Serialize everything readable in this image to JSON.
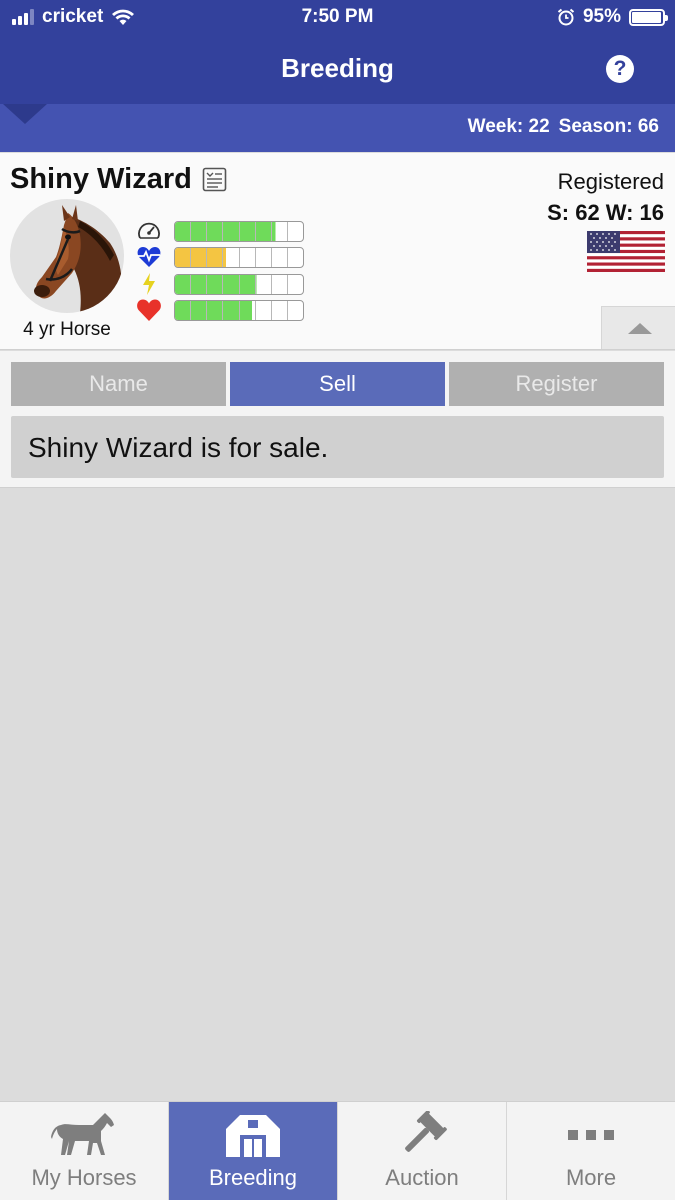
{
  "status_bar": {
    "carrier": "cricket",
    "time": "7:50 PM",
    "battery_percent": "95%",
    "battery_level": 0.95
  },
  "nav": {
    "title": "Breeding",
    "help_glyph": "?"
  },
  "week_bar": {
    "week_label": "Week: 22",
    "season_label": "Season: 66"
  },
  "horse": {
    "name": "Shiny Wizard",
    "age_label": "4 yr Horse",
    "registration_status": "Registered",
    "stat_s": "S: 62",
    "stat_w": "W: 16",
    "flag_icon": "us-flag-icon",
    "stats": [
      {
        "icon": "speed-gauge-icon",
        "level": 0.78,
        "color": "#6fdb5a"
      },
      {
        "icon": "heart-rate-icon",
        "level": 0.4,
        "color": "#f4c542"
      },
      {
        "icon": "lightning-icon",
        "level": 0.63,
        "color": "#6fdb5a"
      },
      {
        "icon": "heart-icon",
        "level": 0.6,
        "color": "#6fdb5a"
      }
    ]
  },
  "tabs": [
    {
      "label": "Name",
      "active": false
    },
    {
      "label": "Sell",
      "active": true
    },
    {
      "label": "Register",
      "active": false
    }
  ],
  "message": "Shiny Wizard is for sale.",
  "tab_bar": [
    {
      "label": "My Horses",
      "icon": "horse-icon",
      "active": false
    },
    {
      "label": "Breeding",
      "icon": "barn-icon",
      "active": true
    },
    {
      "label": "Auction",
      "icon": "gavel-icon",
      "active": false
    },
    {
      "label": "More",
      "icon": "more-dots-icon",
      "active": false
    }
  ],
  "colors": {
    "nav_blue": "#33419c",
    "week_bar_blue": "#4453b1",
    "active_tab": "#5a6bb9"
  }
}
